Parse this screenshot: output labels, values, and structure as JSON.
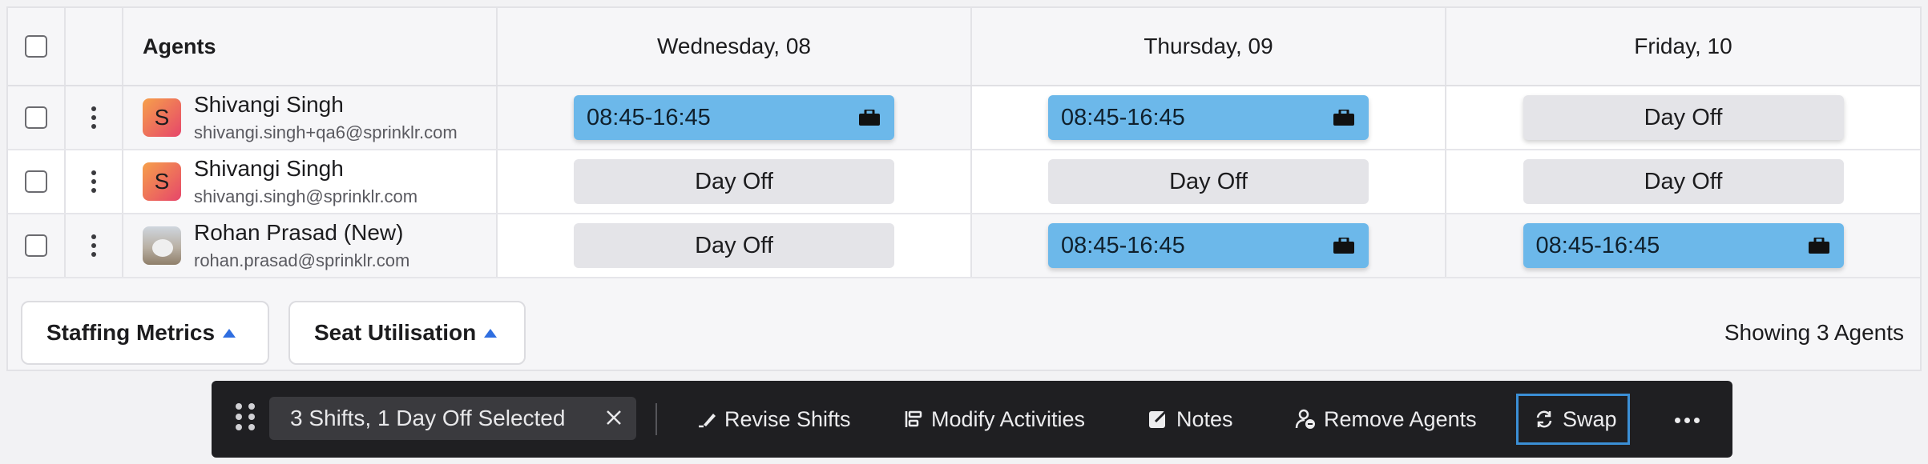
{
  "table": {
    "header": {
      "agents": "Agents",
      "days": [
        "Wednesday, 08",
        "Thursday, 09",
        "Friday, 10"
      ]
    },
    "rows": [
      {
        "name": "Shivangi Singh",
        "email": "shivangi.singh+qa6@sprinklr.com",
        "avatar_letter": "S",
        "cells": [
          {
            "type": "shift",
            "label": "08:45-16:45"
          },
          {
            "type": "shift",
            "label": "08:45-16:45"
          },
          {
            "type": "off",
            "label": "Day Off"
          }
        ]
      },
      {
        "name": "Shivangi Singh",
        "email": "shivangi.singh@sprinklr.com",
        "avatar_letter": "S",
        "cells": [
          {
            "type": "off",
            "label": "Day Off"
          },
          {
            "type": "off",
            "label": "Day Off"
          },
          {
            "type": "off",
            "label": "Day Off"
          }
        ]
      },
      {
        "name": "Rohan Prasad (New)",
        "email": "rohan.prasad@sprinklr.com",
        "avatar_letter": "",
        "cells": [
          {
            "type": "off",
            "label": "Day Off"
          },
          {
            "type": "shift",
            "label": "08:45-16:45"
          },
          {
            "type": "shift",
            "label": "08:45-16:45"
          }
        ]
      }
    ]
  },
  "footer": {
    "staffing_metrics": "Staffing Metrics",
    "seat_utilisation": "Seat Utilisation",
    "showing": "Showing 3 Agents"
  },
  "action_bar": {
    "selection": "3 Shifts, 1 Day Off Selected",
    "revise_shifts": "Revise Shifts",
    "modify_activities": "Modify Activities",
    "notes": "Notes",
    "remove_agents": "Remove Agents",
    "swap": "Swap"
  },
  "colors": {
    "shift_blue": "#6cb8ea",
    "day_off_gray": "#e4e4e8",
    "action_bar_bg": "#1f1f22",
    "swap_focus": "#3b8fd6",
    "metric_arrow": "#2f6ee0"
  },
  "icons": [
    "kebab-icon",
    "briefcase-icon",
    "caret-up-icon",
    "drag-handle-icon",
    "close-icon",
    "pencil-icon",
    "activities-icon",
    "notes-icon",
    "remove-user-icon",
    "swap-icon",
    "more-icon"
  ]
}
